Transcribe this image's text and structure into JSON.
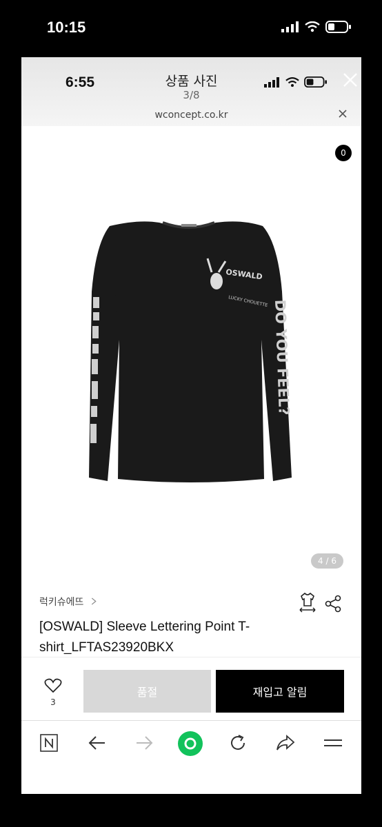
{
  "outer_status": {
    "time": "10:15"
  },
  "inner_status": {
    "time": "6:55"
  },
  "viewer": {
    "title": "상품 사진",
    "count": "3/8",
    "url": "wconcept.co.kr"
  },
  "app_bar": {
    "cart_count": "0"
  },
  "product_image": {
    "counter": "4 / 6",
    "shirt_color": "#1a1a1a",
    "print_text": {
      "chest_top": "OSWALD",
      "chest_bottom": "LUCKY CHOUETTE",
      "right_sleeve": "DO YOU FEEL?"
    }
  },
  "product": {
    "brand": "럭키슈에뜨",
    "title": "[OSWALD] Sleeve Lettering Point T-shirt_LFTAS23920BKX"
  },
  "actions": {
    "like_count": "3",
    "soldout_label": "품절",
    "restock_label": "재입고 알림"
  },
  "colors": {
    "accent_green": "#12c25b",
    "soldout_gray": "#d8d8d8"
  }
}
